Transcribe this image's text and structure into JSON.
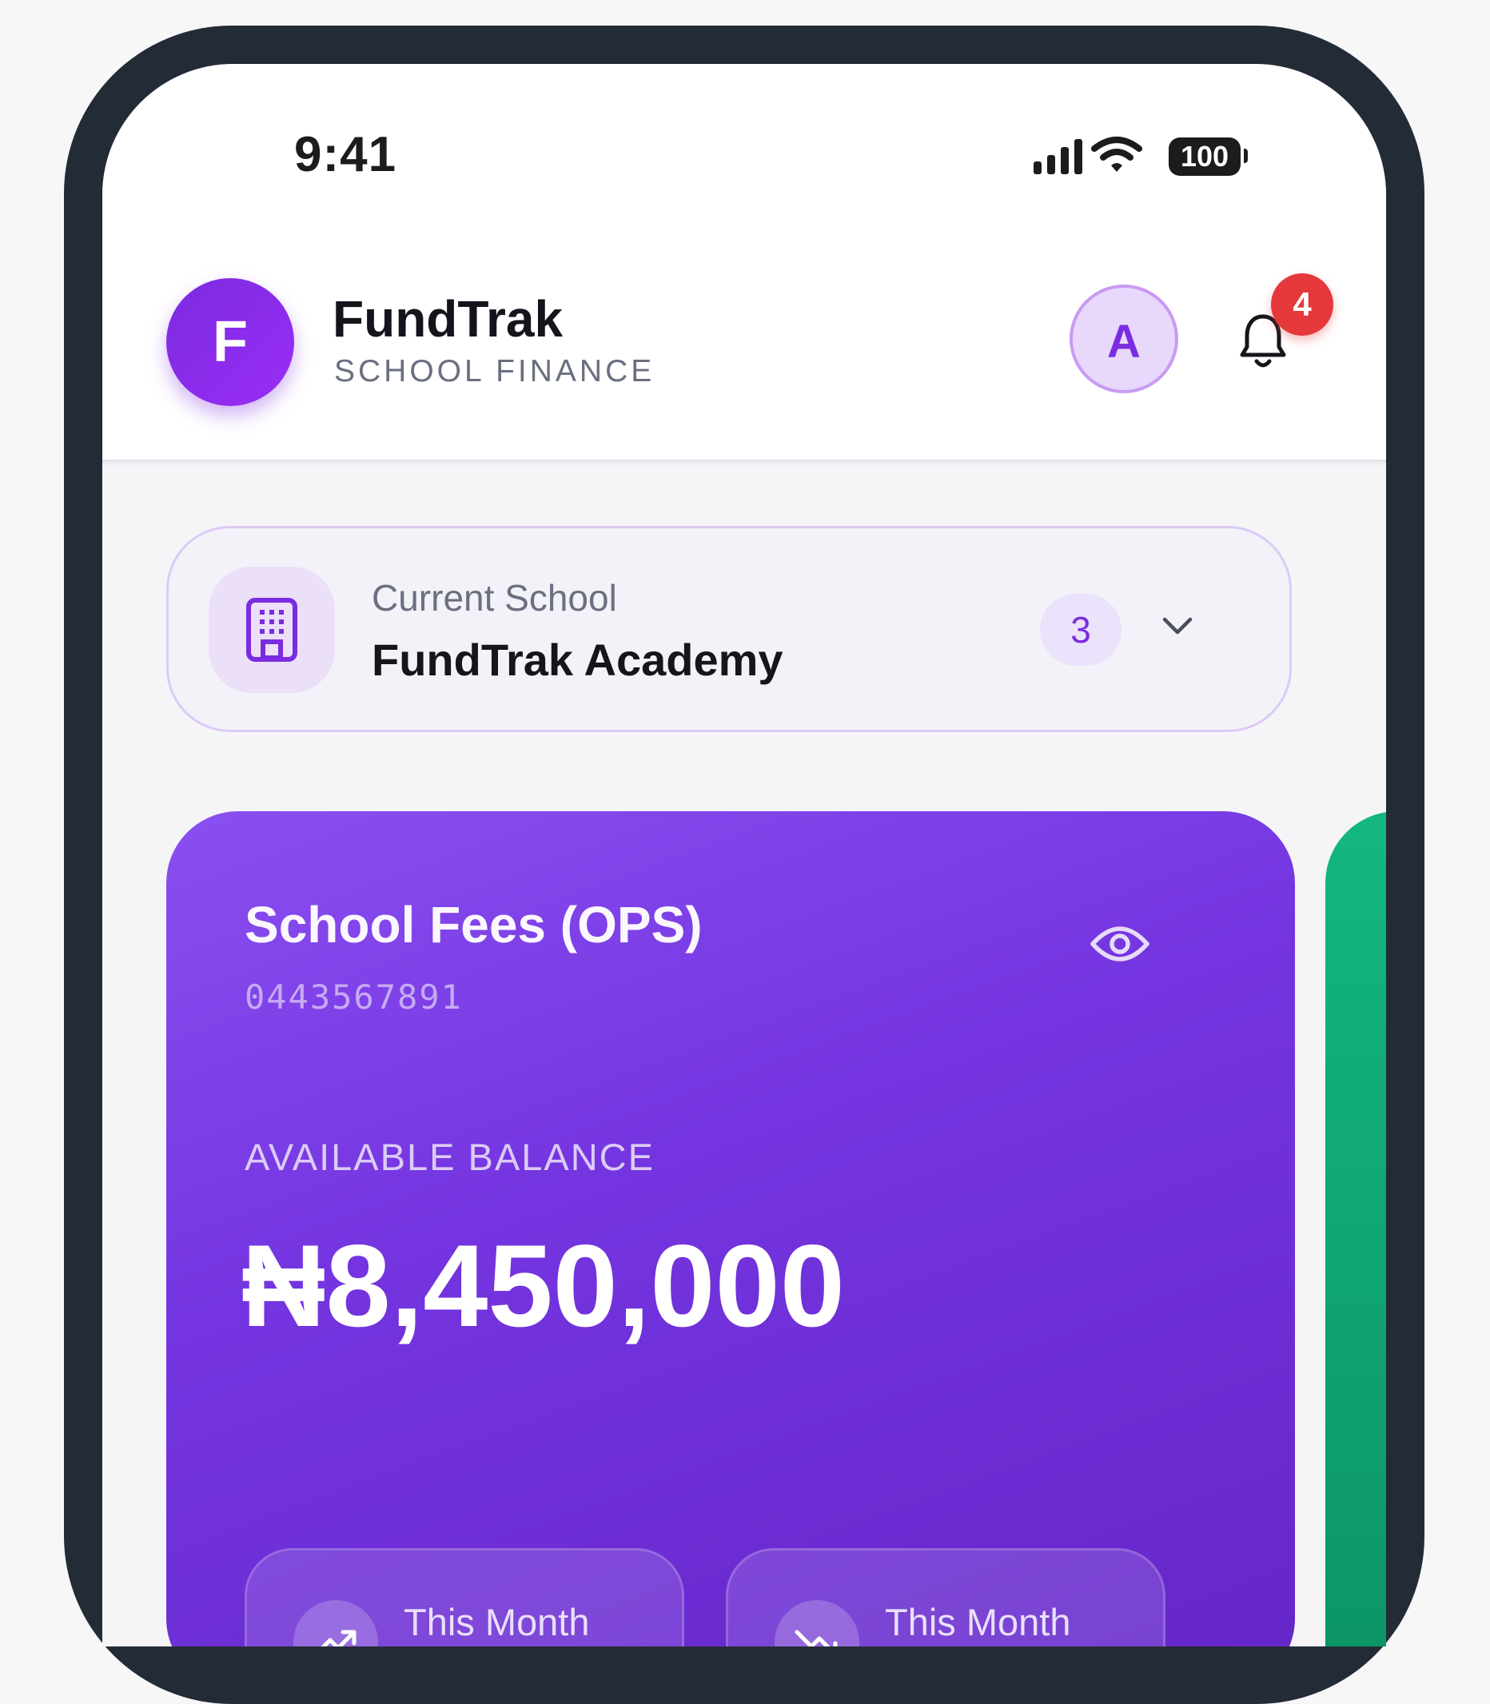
{
  "status_bar": {
    "time": "9:41",
    "battery": "100",
    "icons": [
      "cellular-signal-icon",
      "wifi-icon",
      "battery-icon"
    ]
  },
  "header": {
    "logo_letter": "F",
    "app_name": "FundTrak",
    "app_subtitle": "SCHOOL FINANCE",
    "avatar_letter": "A",
    "notification_count": "4"
  },
  "school_selector": {
    "label": "Current School",
    "name": "FundTrak Academy",
    "count": "3",
    "icon": "building-icon"
  },
  "account_card": {
    "title": "School Fees (OPS)",
    "account_number": "0443567891",
    "balance_label": "AVAILABLE BALANCE",
    "balance": "₦8,450,000",
    "stats": [
      {
        "label": "This Month",
        "icon": "trending-up-icon"
      },
      {
        "label": "This Month",
        "icon": "trending-down-icon"
      }
    ]
  },
  "colors": {
    "brand_purple": "#7b2ce0",
    "card_gradient_start": "#8a4ff0",
    "card_gradient_end": "#6426c8",
    "secondary_card_green": "#14b77e",
    "badge_red": "#e5383b",
    "phone_frame": "#232c36"
  }
}
